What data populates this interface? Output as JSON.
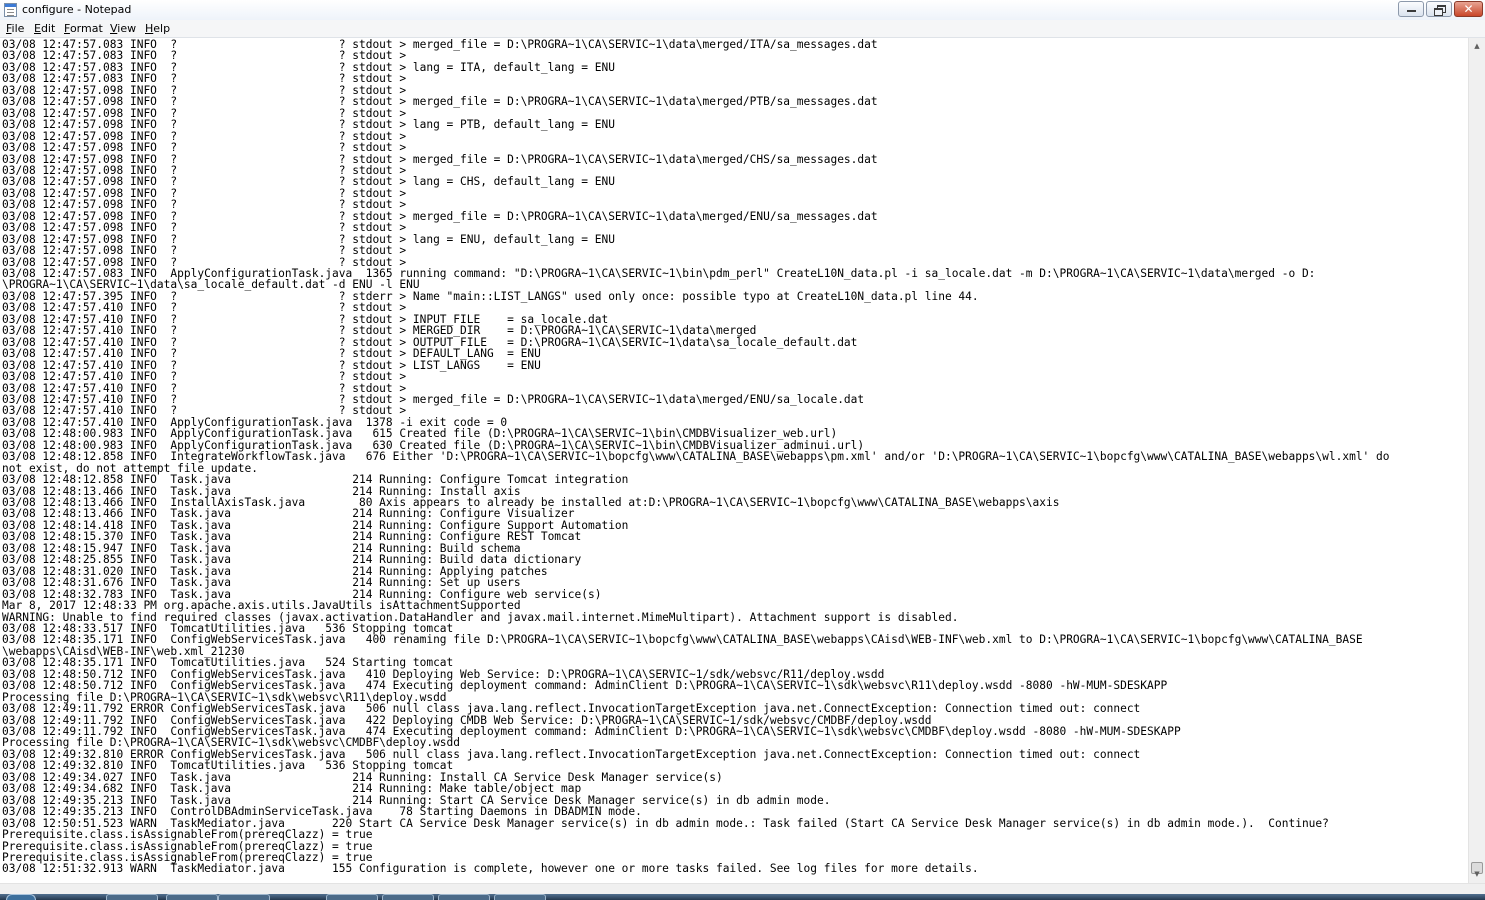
{
  "window": {
    "title": "configure - Notepad",
    "close_glyph": "✕"
  },
  "menu": [
    "File",
    "Edit",
    "Format",
    "View",
    "Help"
  ],
  "scroll": {
    "up_arrow": "▲",
    "down_arrow": "▼"
  },
  "log_lines": [
    "03/08 12:47:57.083 INFO  ?                        ? stdout > merged_file = D:\\PROGRA~1\\CA\\SERVIC~1\\data\\merged/ITA/sa_messages.dat",
    "03/08 12:47:57.083 INFO  ?                        ? stdout >",
    "03/08 12:47:57.083 INFO  ?                        ? stdout > lang = ITA, default_lang = ENU",
    "03/08 12:47:57.083 INFO  ?                        ? stdout >",
    "03/08 12:47:57.098 INFO  ?                        ? stdout >",
    "03/08 12:47:57.098 INFO  ?                        ? stdout > merged_file = D:\\PROGRA~1\\CA\\SERVIC~1\\data\\merged/PTB/sa_messages.dat",
    "03/08 12:47:57.098 INFO  ?                        ? stdout >",
    "03/08 12:47:57.098 INFO  ?                        ? stdout > lang = PTB, default_lang = ENU",
    "03/08 12:47:57.098 INFO  ?                        ? stdout >",
    "03/08 12:47:57.098 INFO  ?                        ? stdout >",
    "03/08 12:47:57.098 INFO  ?                        ? stdout > merged_file = D:\\PROGRA~1\\CA\\SERVIC~1\\data\\merged/CHS/sa_messages.dat",
    "03/08 12:47:57.098 INFO  ?                        ? stdout >",
    "03/08 12:47:57.098 INFO  ?                        ? stdout > lang = CHS, default_lang = ENU",
    "03/08 12:47:57.098 INFO  ?                        ? stdout >",
    "03/08 12:47:57.098 INFO  ?                        ? stdout >",
    "03/08 12:47:57.098 INFO  ?                        ? stdout > merged_file = D:\\PROGRA~1\\CA\\SERVIC~1\\data\\merged/ENU/sa_messages.dat",
    "03/08 12:47:57.098 INFO  ?                        ? stdout >",
    "03/08 12:47:57.098 INFO  ?                        ? stdout > lang = ENU, default_lang = ENU",
    "03/08 12:47:57.098 INFO  ?                        ? stdout >",
    "03/08 12:47:57.098 INFO  ?                        ? stdout >",
    "03/08 12:47:57.083 INFO  ApplyConfigurationTask.java  1365 running command: \"D:\\PROGRA~1\\CA\\SERVIC~1\\bin\\pdm_perl\" CreateL10N_data.pl -i sa_locale.dat -m D:\\PROGRA~1\\CA\\SERVIC~1\\data\\merged -o D:",
    "\\PROGRA~1\\CA\\SERVIC~1\\data\\sa_locale_default.dat -d ENU -l ENU",
    "03/08 12:47:57.395 INFO  ?                        ? stderr > Name \"main::LIST_LANGS\" used only once: possible typo at CreateL10N_data.pl line 44.",
    "03/08 12:47:57.410 INFO  ?                        ? stdout >",
    "03/08 12:47:57.410 INFO  ?                        ? stdout > INPUT_FILE    = sa_locale.dat",
    "03/08 12:47:57.410 INFO  ?                        ? stdout > MERGED_DIR    = D:\\PROGRA~1\\CA\\SERVIC~1\\data\\merged",
    "03/08 12:47:57.410 INFO  ?                        ? stdout > OUTPUT_FILE   = D:\\PROGRA~1\\CA\\SERVIC~1\\data\\sa_locale_default.dat",
    "03/08 12:47:57.410 INFO  ?                        ? stdout > DEFAULT_LANG  = ENU",
    "03/08 12:47:57.410 INFO  ?                        ? stdout > LIST_LANGS    = ENU",
    "03/08 12:47:57.410 INFO  ?                        ? stdout >",
    "03/08 12:47:57.410 INFO  ?                        ? stdout >",
    "03/08 12:47:57.410 INFO  ?                        ? stdout > merged_file = D:\\PROGRA~1\\CA\\SERVIC~1\\data\\merged/ENU/sa_locale.dat",
    "03/08 12:47:57.410 INFO  ?                        ? stdout >",
    "03/08 12:47:57.410 INFO  ApplyConfigurationTask.java  1378 -i exit code = 0",
    "03/08 12:48:00.983 INFO  ApplyConfigurationTask.java   615 Created file (D:\\PROGRA~1\\CA\\SERVIC~1\\bin\\CMDBVisualizer_web.url)",
    "03/08 12:48:00.983 INFO  ApplyConfigurationTask.java   630 Created file (D:\\PROGRA~1\\CA\\SERVIC~1\\bin\\CMDBVisualizer_adminui.url)",
    "03/08 12:48:12.858 INFO  IntegrateWorkflowTask.java   676 Either 'D:\\PROGRA~1\\CA\\SERVIC~1\\bopcfg\\www\\CATALINA_BASE\\webapps\\pm.xml' and/or 'D:\\PROGRA~1\\CA\\SERVIC~1\\bopcfg\\www\\CATALINA_BASE\\webapps\\wl.xml' do",
    "not exist, do not attempt file update.",
    "03/08 12:48:12.858 INFO  Task.java                  214 Running: Configure Tomcat integration",
    "03/08 12:48:13.466 INFO  Task.java                  214 Running: Install axis",
    "03/08 12:48:13.466 INFO  InstallAxisTask.java        80 Axis appears to already be installed at:D:\\PROGRA~1\\CA\\SERVIC~1\\bopcfg\\www\\CATALINA_BASE\\webapps\\axis",
    "03/08 12:48:13.466 INFO  Task.java                  214 Running: Configure Visualizer",
    "03/08 12:48:14.418 INFO  Task.java                  214 Running: Configure Support Automation",
    "03/08 12:48:15.370 INFO  Task.java                  214 Running: Configure REST Tomcat",
    "03/08 12:48:15.947 INFO  Task.java                  214 Running: Build schema",
    "03/08 12:48:25.855 INFO  Task.java                  214 Running: Build data dictionary",
    "03/08 12:48:31.020 INFO  Task.java                  214 Running: Applying patches",
    "03/08 12:48:31.676 INFO  Task.java                  214 Running: Set up users",
    "03/08 12:48:32.783 INFO  Task.java                  214 Running: Configure web service(s)",
    "Mar 8, 2017 12:48:33 PM org.apache.axis.utils.JavaUtils isAttachmentSupported",
    "WARNING: Unable to find required classes (javax.activation.DataHandler and javax.mail.internet.MimeMultipart). Attachment support is disabled.",
    "03/08 12:48:33.517 INFO  TomcatUtilities.java   536 Stopping tomcat",
    "03/08 12:48:35.171 INFO  ConfigWebServicesTask.java   400 renaming file D:\\PROGRA~1\\CA\\SERVIC~1\\bopcfg\\www\\CATALINA_BASE\\webapps\\CAisd\\WEB-INF\\web.xml to D:\\PROGRA~1\\CA\\SERVIC~1\\bopcfg\\www\\CATALINA_BASE",
    "\\webapps\\CAisd\\WEB-INF\\web.xml_21230",
    "03/08 12:48:35.171 INFO  TomcatUtilities.java   524 Starting tomcat",
    "03/08 12:48:50.712 INFO  ConfigWebServicesTask.java   410 Deploying Web Service: D:\\PROGRA~1\\CA\\SERVIC~1/sdk/websvc/R11/deploy.wsdd",
    "03/08 12:48:50.712 INFO  ConfigWebServicesTask.java   474 Executing deployment command: AdminClient D:\\PROGRA~1\\CA\\SERVIC~1\\sdk\\websvc\\R11\\deploy.wsdd -8080 -hW-MUM-SDESKAPP",
    "Processing file D:\\PROGRA~1\\CA\\SERVIC~1\\sdk\\websvc\\R11\\deploy.wsdd",
    "03/08 12:49:11.792 ERROR ConfigWebServicesTask.java   506 null class java.lang.reflect.InvocationTargetException java.net.ConnectException: Connection timed out: connect",
    "03/08 12:49:11.792 INFO  ConfigWebServicesTask.java   422 Deploying CMDB Web Service: D:\\PROGRA~1\\CA\\SERVIC~1/sdk/websvc/CMDBF/deploy.wsdd",
    "03/08 12:49:11.792 INFO  ConfigWebServicesTask.java   474 Executing deployment command: AdminClient D:\\PROGRA~1\\CA\\SERVIC~1\\sdk\\websvc\\CMDBF\\deploy.wsdd -8080 -hW-MUM-SDESKAPP",
    "Processing file D:\\PROGRA~1\\CA\\SERVIC~1\\sdk\\websvc\\CMDBF\\deploy.wsdd",
    "03/08 12:49:32.810 ERROR ConfigWebServicesTask.java   506 null class java.lang.reflect.InvocationTargetException java.net.ConnectException: Connection timed out: connect",
    "03/08 12:49:32.810 INFO  TomcatUtilities.java   536 Stopping tomcat",
    "03/08 12:49:34.027 INFO  Task.java                  214 Running: Install CA Service Desk Manager service(s)",
    "03/08 12:49:34.682 INFO  Task.java                  214 Running: Make table/object map",
    "03/08 12:49:35.213 INFO  Task.java                  214 Running: Start CA Service Desk Manager service(s) in db admin mode.",
    "03/08 12:49:35.213 INFO  ControlDBAdminServiceTask.java    78 Starting Daemons in DBADMIN mode.",
    "03/08 12:50:51.523 WARN  TaskMediator.java       220 Start CA Service Desk Manager service(s) in db admin mode.: Task failed (Start CA Service Desk Manager service(s) in db admin mode.).  Continue?",
    "Prerequisite.class.isAssignableFrom(prereqClazz) = true",
    "Prerequisite.class.isAssignableFrom(prereqClazz) = true",
    "Prerequisite.class.isAssignableFrom(prereqClazz) = true",
    "03/08 12:51:32.913 WARN  TaskMediator.java       155 Configuration is complete, however one or more tasks failed. See log files for more details."
  ]
}
